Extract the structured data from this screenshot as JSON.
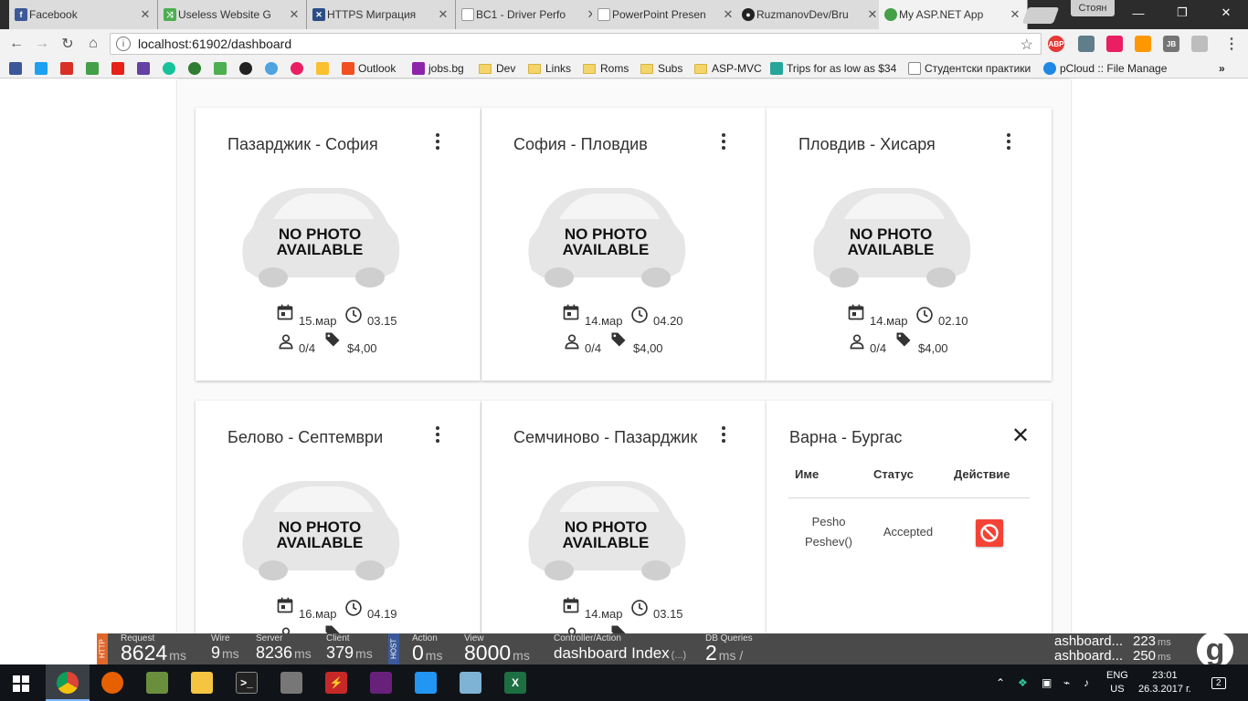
{
  "browser": {
    "tabs": [
      {
        "title": "Facebook",
        "icon": "facebook-icon",
        "color": "#3b5998",
        "glyph": "f"
      },
      {
        "title": "Useless Website G",
        "icon": "shuffle-icon",
        "color": "#4caf50",
        "glyph": "⤨"
      },
      {
        "title": "HTTPS Миграция",
        "icon": "site-icon",
        "color": "#2c4e86",
        "glyph": "✕"
      },
      {
        "title": "BC1 - Driver Perfo",
        "icon": "document-icon",
        "color": "#9e9e9e",
        "glyph": ""
      },
      {
        "title": "PowerPoint Presen",
        "icon": "document-icon",
        "color": "#9e9e9e",
        "glyph": ""
      },
      {
        "title": "RuzmanovDev/Bru",
        "icon": "github-icon",
        "color": "#222222",
        "glyph": "●"
      },
      {
        "title": "My ASP.NET App",
        "icon": "car-icon",
        "color": "#43a047",
        "glyph": "▬"
      }
    ],
    "profile": "Стоян",
    "address": "localhost:61902/dashboard",
    "bookmarks": [
      {
        "label": "Outlook",
        "type": "site",
        "color": "#e74c3c"
      },
      {
        "label": "jobs.bg",
        "type": "site",
        "color": "#8e24aa"
      },
      {
        "label": "Dev",
        "type": "folder"
      },
      {
        "label": "Links",
        "type": "folder"
      },
      {
        "label": "Roms",
        "type": "folder"
      },
      {
        "label": "Subs",
        "type": "folder"
      },
      {
        "label": "ASP-MVC",
        "type": "folder"
      },
      {
        "label": "Trips for as low as $34",
        "type": "site",
        "color": "#26a69a"
      },
      {
        "label": "Студентски практики",
        "type": "page"
      },
      {
        "label": "pCloud :: File Manage",
        "type": "site",
        "color": "#1e88e5"
      }
    ],
    "more_bookmarks": "»"
  },
  "cards": [
    {
      "title": "Пазарджик - София",
      "date": "15.мар",
      "time": "03.15",
      "seats": "0/4",
      "price": "$4,00"
    },
    {
      "title": "София - Пловдив",
      "date": "14.мар",
      "time": "04.20",
      "seats": "0/4",
      "price": "$4,00"
    },
    {
      "title": "Пловдив - Хисаря",
      "date": "14.мар",
      "time": "02.10",
      "seats": "0/4",
      "price": "$4,00"
    },
    {
      "title": "Белово - Септември",
      "date": "16.мар",
      "time": "04.19",
      "seats": "",
      "price": ""
    },
    {
      "title": "Семчиново - Пазарджик",
      "date": "14.мар",
      "time": "03.15",
      "seats": "",
      "price": ""
    }
  ],
  "no_photo": {
    "line1": "NO PHOTO",
    "line2": "AVAILABLE"
  },
  "passengers_panel": {
    "title": "Варна - Бургас",
    "columns": {
      "name": "Име",
      "status": "Статус",
      "action": "Действие"
    },
    "rows": [
      {
        "name_line1": "Pesho",
        "name_line2": "Peshev()",
        "status": "Accepted"
      }
    ]
  },
  "glimpse": {
    "tags": {
      "http": "HTTP",
      "host": "HOST"
    },
    "stats": [
      {
        "label": "Request",
        "value": "8624",
        "unit": "ms"
      },
      {
        "label": "Wire",
        "value": "9",
        "unit": "ms"
      },
      {
        "label": "Server",
        "value": "8236",
        "unit": "ms"
      },
      {
        "label": "Client",
        "value": "379",
        "unit": "ms"
      },
      {
        "label": "Action",
        "value": "0",
        "unit": "ms"
      },
      {
        "label": "View",
        "value": "8000",
        "unit": "ms"
      },
      {
        "label": "Controller/Action",
        "value": "dashboard Index",
        "unit": "(...)"
      },
      {
        "label": "DB Queries",
        "value": "2",
        "unit": "ms  /"
      }
    ],
    "history": [
      {
        "name": "ashboard...",
        "time": "223",
        "unit": "ms"
      },
      {
        "name": "ashboard...",
        "time": "250",
        "unit": "ms"
      }
    ],
    "logo": "g"
  },
  "taskbar": {
    "lang_line1": "ENG",
    "lang_line2": "US",
    "time": "23:01",
    "date": "26.3.2017 г.",
    "notifications": "2"
  }
}
